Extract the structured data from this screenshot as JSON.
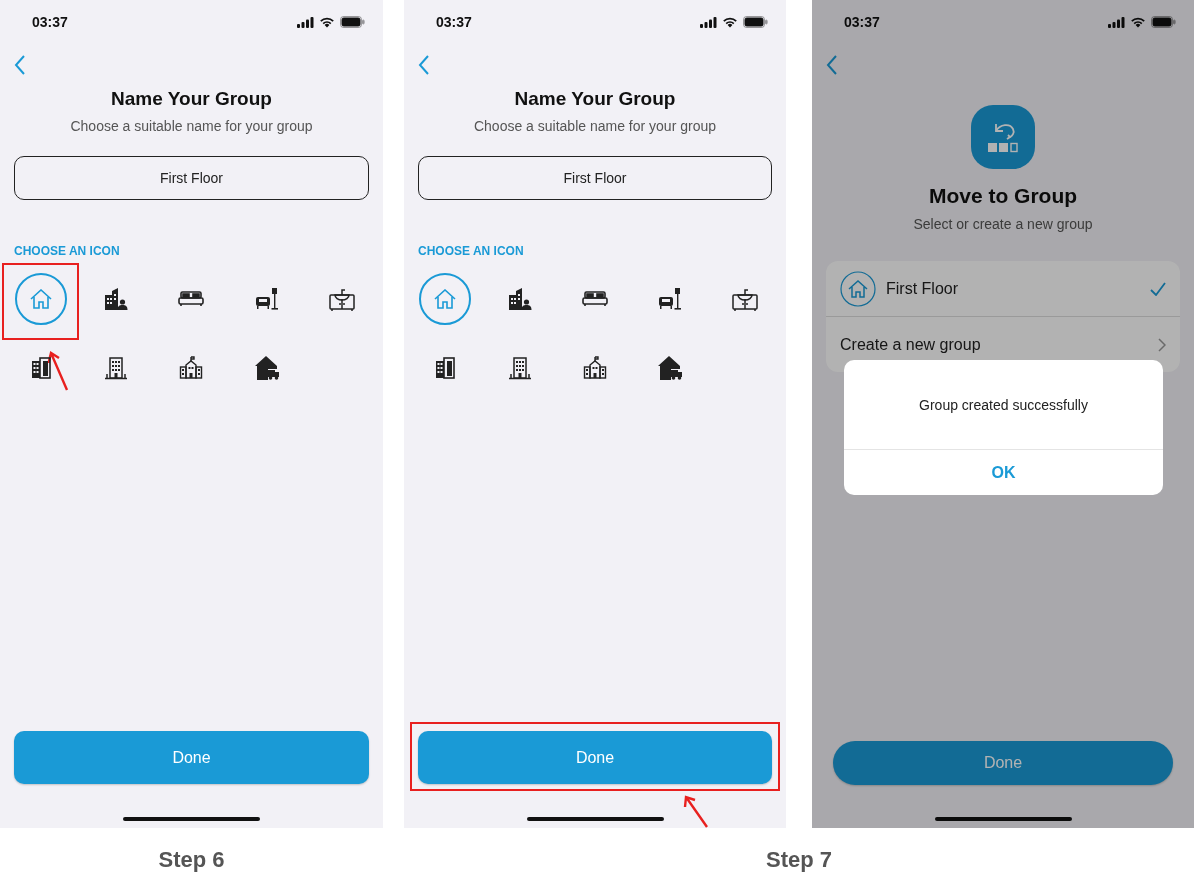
{
  "screens": [
    {
      "kind": "name_group",
      "time": "03:37",
      "title": "Name Your Group",
      "subtitle": "Choose a suitable name for your group",
      "name_value": "First Floor",
      "section_label": "CHOOSE AN ICON",
      "icons": [
        {
          "selected": true,
          "highlighted": true
        },
        {
          "selected": false,
          "highlighted": false
        },
        {
          "selected": false,
          "highlighted": false
        },
        {
          "selected": false,
          "highlighted": false
        },
        {
          "selected": false,
          "highlighted": false
        },
        {
          "selected": false,
          "highlighted": false
        },
        {
          "selected": false,
          "highlighted": false
        },
        {
          "selected": false,
          "highlighted": false
        },
        {
          "selected": false,
          "highlighted": false
        }
      ],
      "done_button": {
        "label": "Done",
        "highlighted": false
      }
    },
    {
      "kind": "name_group",
      "time": "03:37",
      "title": "Name Your Group",
      "subtitle": "Choose a suitable name for your group",
      "name_value": "First Floor",
      "section_label": "CHOOSE AN ICON",
      "icons": [
        {
          "selected": true,
          "highlighted": false
        },
        {
          "selected": false,
          "highlighted": false
        },
        {
          "selected": false,
          "highlighted": false
        },
        {
          "selected": false,
          "highlighted": false
        },
        {
          "selected": false,
          "highlighted": false
        },
        {
          "selected": false,
          "highlighted": false
        },
        {
          "selected": false,
          "highlighted": false
        },
        {
          "selected": false,
          "highlighted": false
        },
        {
          "selected": false,
          "highlighted": false
        }
      ],
      "done_button": {
        "label": "Done",
        "highlighted": true
      }
    },
    {
      "kind": "move_group",
      "time": "03:37",
      "title": "Move to Group",
      "subtitle": "Select or create a new group",
      "groups": [
        {
          "name": "First Floor",
          "selected": true
        }
      ],
      "create_label": "Create a new group",
      "dialog": {
        "message": "Group created successfully",
        "button": "OK"
      },
      "done_button": {
        "label": "Done"
      }
    }
  ],
  "captions": [
    {
      "label": "Step 6"
    },
    {
      "label": "Step 7"
    }
  ]
}
